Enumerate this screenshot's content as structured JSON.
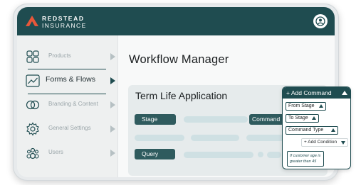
{
  "brand": {
    "line1": "REDSTEAD",
    "line2": "INSURANCE",
    "accent_color": "#e8573a"
  },
  "topbar": {
    "color": "#1f4c50",
    "profile_icon": "user-circle-icon"
  },
  "sidebar": {
    "items": [
      {
        "label": "Products",
        "icon": "grid-icon",
        "active": false
      },
      {
        "label": "Forms & Flows",
        "icon": "trend-line-icon",
        "active": true
      },
      {
        "label": "Branding & Content",
        "icon": "overlap-circles-icon",
        "active": false
      },
      {
        "label": "General Settings",
        "icon": "gear-icon",
        "active": false
      },
      {
        "label": "Users",
        "icon": "users-icon",
        "active": false
      }
    ]
  },
  "main": {
    "title": "Workflow Manager",
    "card": {
      "title": "Term Life Application",
      "tags": {
        "stage": "Stage",
        "command": "Command",
        "query": "Query"
      }
    }
  },
  "popover": {
    "header": "+ Add Command",
    "chips": [
      "From Stage",
      "To Stage",
      "Command Type"
    ],
    "add_condition": "+ Add Condition",
    "note": "If customer age is greater than 45"
  }
}
